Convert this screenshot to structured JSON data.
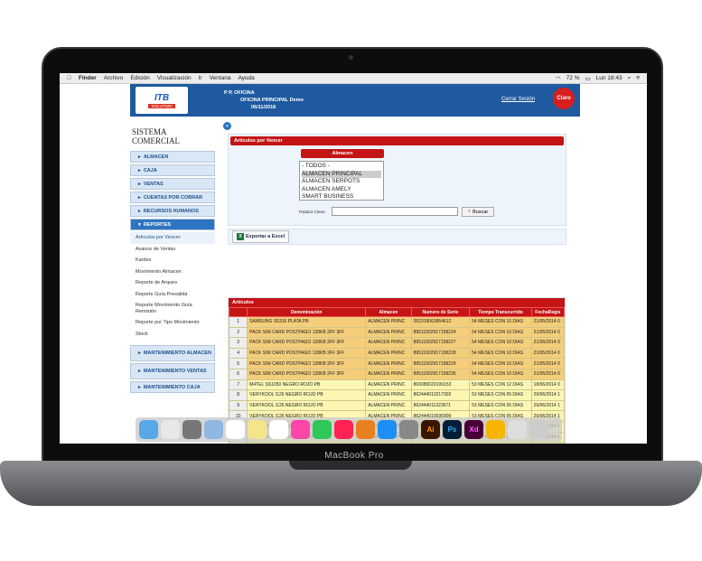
{
  "menubar": {
    "apple": "",
    "finder": "Finder",
    "items": [
      "Archivo",
      "Edición",
      "Visualización",
      "Ir",
      "Ventana",
      "Ayuda"
    ],
    "battery": "72 %",
    "clock": "Lun 18:43"
  },
  "header": {
    "logo_top": "ITB",
    "logo_bottom": "SOLUTION",
    "line1": "P P, OFICINA",
    "line2": "OFICINA PRINCIPAL Demo",
    "line3": "06/11/2018",
    "logout": "Cerrar Sesión",
    "brand": "Claro"
  },
  "sidebar": {
    "title": "SISTEMA COMERCIAL",
    "menus": [
      "ALMACEN",
      "CAJA",
      "VENTAS",
      "CUENTAS POR COBRAR",
      "RECURSOS HUMANOS"
    ],
    "reportes": "REPORTES",
    "subitems": [
      "Artículos por Vencer",
      "Avance de Ventas",
      "Kardex",
      "Movimiento Almacen",
      "Reporte de Arqueo",
      "Reporte Guía Presalida",
      "Reporte Movimiento Guía Remisión",
      "Reporte por Tipo Movimiento",
      "Stock"
    ],
    "maint": [
      "MANTENIMIENTO ALMACEN",
      "MANTENIMIENTO VENTAS",
      "MANTENIMIENTO CAJA"
    ]
  },
  "panel": {
    "title": "Artículos por Vencer",
    "almacen_label": "Almacen",
    "options": [
      "- TODOS -",
      "ALMACEN PRINCIPAL",
      "ALMACEN SERPOTS",
      "ALMACEN AMELY",
      "SMART BUSINESS"
    ],
    "keyword_label": "Palabra Clave:",
    "search": "Buscar",
    "export": "Exportar a Excel"
  },
  "articles": {
    "title": "Artículos",
    "columns": [
      "",
      "Denominación",
      "Almacen",
      "Numero de Serie",
      "Tiempo Transcurrido",
      "FechaRegis"
    ],
    "rows": [
      [
        "1",
        "SAMSUNG S5310 PLATA PB",
        "ALMACEN PRINC",
        "352319063954612",
        "54 MESES CON 10 DIAS",
        "21/05/2014 0"
      ],
      [
        "2",
        "PACK SIM CARD POSTPAGO 128KB 2FF 3FF",
        "ALMACEN PRINC",
        "89511002917158224",
        "54 MESES CON 10 DIAS",
        "21/05/2014 0"
      ],
      [
        "3",
        "PACK SIM CARD POSTPAGO 128KB 2FF 3FF",
        "ALMACEN PRINC",
        "89511002917158227",
        "54 MESES CON 10 DIAS",
        "21/05/2014 0"
      ],
      [
        "4",
        "PACK SIM CARD POSTPAGO 128KB 2FF 3FF",
        "ALMACEN PRINC",
        "89511002917158228",
        "54 MESES CON 10 DIAS",
        "21/05/2014 0"
      ],
      [
        "5",
        "PACK SIM CARD POSTPAGO 128KB 2FF 3FF",
        "ALMACEN PRINC",
        "89511002917158229",
        "54 MESES CON 10 DIAS",
        "21/05/2014 0"
      ],
      [
        "6",
        "PACK SIM CARD POSTPAGO 128KB 2FF 3FF",
        "ALMACEN PRINC",
        "89511002917158236",
        "54 MESES CON 10 DIAS",
        "21/05/2014 0"
      ],
      [
        "7",
        "M4TEL SS1050 NEGRO ROJO PB",
        "ALMACEN PRINC",
        "863089020199153",
        "53 MESES CON 12 DIAS",
        "18/06/2014 0"
      ],
      [
        "8",
        "VERYKOOL I126 NEGRO ROJO PB",
        "ALMACEN PRINC",
        "862444010217302",
        "53 MESES CON 05 DIAS",
        "26/06/2014 1"
      ],
      [
        "9",
        "VERYKOOL I126 NEGRO ROJO PB",
        "ALMACEN PRINC",
        "862444011223671",
        "53 MESES CON 05 DIAS",
        "26/06/2014 1"
      ],
      [
        "10",
        "VERYKOOL I126 NEGRO ROJO PB",
        "ALMACEN PRINC",
        "862444010036909",
        "53 MESES CON 05 DIAS",
        "26/06/2014 1"
      ],
      [
        "11",
        "VERYKOOL I126 NEGRO ROJO PB",
        "ALMACEN PRINC",
        "862444010932900",
        "53 MESES CON 05 DIAS",
        "26/06/2014 1"
      ],
      [
        "12",
        "VERYKOOL I126 NEGRO ROJO PB",
        "ALMACEN PRINC",
        "862444011143309",
        "53 MESES CON 05 DIAS",
        "26/06/2014 1"
      ],
      [
        "13",
        "LG L3 II NEGRO PB",
        "ALMACEN PRINC",
        "355747055727959",
        "53 MESES CON 25 DIAS",
        "06/07/2014 1"
      ]
    ]
  },
  "laptop": {
    "label": "MacBook Pro"
  },
  "dock": [
    "Finder",
    "Chrome",
    "Launchpad",
    "Preview",
    "Calendar",
    "Notes",
    "Reminders",
    "Photos",
    "Messages",
    "Music",
    "Books",
    "App Store",
    "System Preferences",
    "Ai",
    "Ps",
    "Xd",
    "Sketch",
    "Downloads",
    "Trash"
  ]
}
